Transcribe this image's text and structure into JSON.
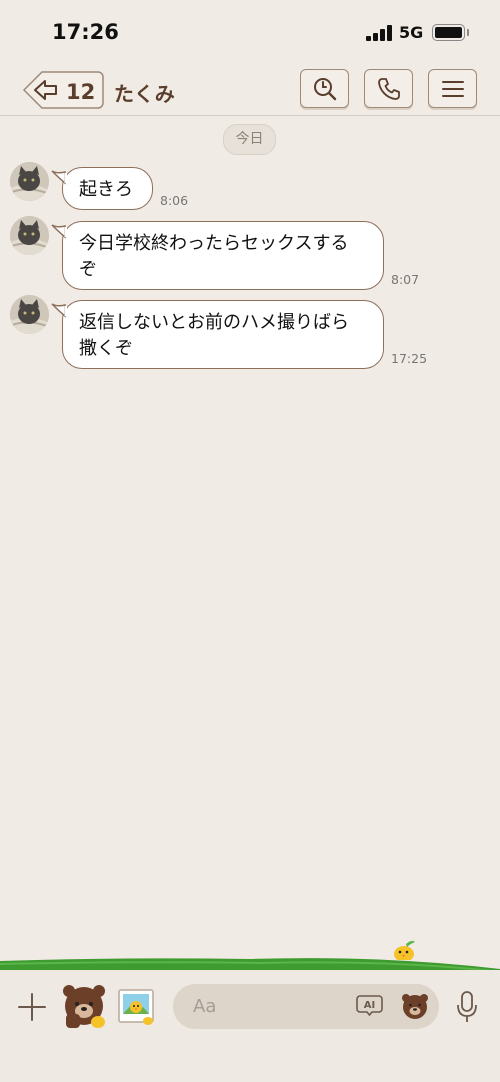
{
  "status_bar": {
    "time": "17:26",
    "network": "5G"
  },
  "header": {
    "unread_count": "12",
    "chat_title": "たくみ"
  },
  "date_divider": "今日",
  "messages": [
    {
      "line1": "起きろ",
      "line2": "",
      "time": "8:06"
    },
    {
      "line1": "今日学校終わったらセックスする",
      "line2": "ぞ",
      "time": "8:07"
    },
    {
      "line1": "返信しないとお前のハメ撮りばら",
      "line2": "撒くぞ",
      "time": "17:25"
    }
  ],
  "input": {
    "placeholder": "Aa",
    "ai_label": "AI"
  },
  "colors": {
    "background": "#f0ebe4",
    "bubble_border": "#8d6f5a",
    "title": "#5a3d2b",
    "grass": "#3d9b2f"
  }
}
